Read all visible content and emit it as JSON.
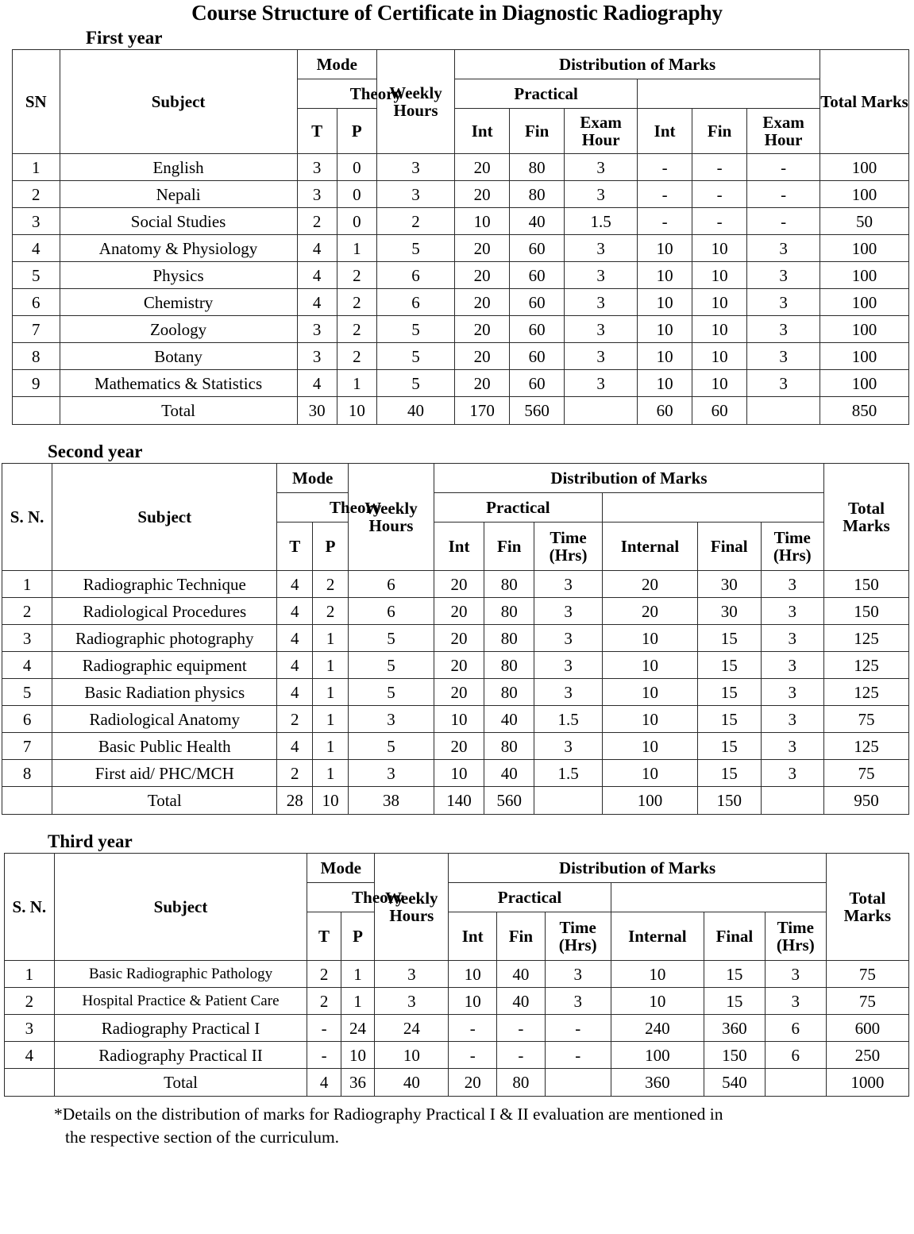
{
  "document": {
    "title": "Course Structure of Certificate in Diagnostic Radiography",
    "footnote_line1": "*Details on the distribution of marks for Radiography Practical I & II evaluation are mentioned in",
    "footnote_line2": "the respective section of the curriculum."
  },
  "tables": [
    {
      "heading": "First year",
      "headers": {
        "sn": "SN",
        "subject": "Subject",
        "mode": "Mode",
        "mode_t": "T",
        "mode_p": "P",
        "weekly_hours": "Weekly Hours",
        "distribution": "Distribution of Marks",
        "theory": "Theory",
        "practical": "Practical",
        "theory_int": "Int",
        "theory_fin": "Fin",
        "theory_time": "Exam Hour",
        "practical_int": "Int",
        "practical_fin": "Fin",
        "practical_time": "Exam Hour",
        "total_marks": "Total Marks"
      },
      "rows": [
        {
          "sn": "1",
          "subject": "English",
          "t": "3",
          "p": "0",
          "weekly": "3",
          "th_int": "20",
          "th_fin": "80",
          "th_time": "3",
          "pr_int": "-",
          "pr_fin": "-",
          "pr_time": "-",
          "total": "100"
        },
        {
          "sn": "2",
          "subject": "Nepali",
          "t": "3",
          "p": "0",
          "weekly": "3",
          "th_int": "20",
          "th_fin": "80",
          "th_time": "3",
          "pr_int": "-",
          "pr_fin": "-",
          "pr_time": "-",
          "total": "100"
        },
        {
          "sn": "3",
          "subject": "Social Studies",
          "t": "2",
          "p": "0",
          "weekly": "2",
          "th_int": "10",
          "th_fin": "40",
          "th_time": "1.5",
          "pr_int": "-",
          "pr_fin": "-",
          "pr_time": "-",
          "total": "50"
        },
        {
          "sn": "4",
          "subject": "Anatomy & Physiology",
          "t": "4",
          "p": "1",
          "weekly": "5",
          "th_int": "20",
          "th_fin": "60",
          "th_time": "3",
          "pr_int": "10",
          "pr_fin": "10",
          "pr_time": "3",
          "total": "100"
        },
        {
          "sn": "5",
          "subject": "Physics",
          "t": "4",
          "p": "2",
          "weekly": "6",
          "th_int": "20",
          "th_fin": "60",
          "th_time": "3",
          "pr_int": "10",
          "pr_fin": "10",
          "pr_time": "3",
          "total": "100"
        },
        {
          "sn": "6",
          "subject": "Chemistry",
          "t": "4",
          "p": "2",
          "weekly": "6",
          "th_int": "20",
          "th_fin": "60",
          "th_time": "3",
          "pr_int": "10",
          "pr_fin": "10",
          "pr_time": "3",
          "total": "100"
        },
        {
          "sn": "7",
          "subject": "Zoology",
          "t": "3",
          "p": "2",
          "weekly": "5",
          "th_int": "20",
          "th_fin": "60",
          "th_time": "3",
          "pr_int": "10",
          "pr_fin": "10",
          "pr_time": "3",
          "total": "100"
        },
        {
          "sn": "8",
          "subject": "Botany",
          "t": "3",
          "p": "2",
          "weekly": "5",
          "th_int": "20",
          "th_fin": "60",
          "th_time": "3",
          "pr_int": "10",
          "pr_fin": "10",
          "pr_time": "3",
          "total": "100"
        },
        {
          "sn": "9",
          "subject": "Mathematics & Statistics",
          "t": "4",
          "p": "1",
          "weekly": "5",
          "th_int": "20",
          "th_fin": "60",
          "th_time": "3",
          "pr_int": "10",
          "pr_fin": "10",
          "pr_time": "3",
          "total": "100"
        }
      ],
      "total": {
        "sn": "",
        "label": "Total",
        "t": "30",
        "p": "10",
        "weekly": "40",
        "th_int": "170",
        "th_fin": "560",
        "th_time": "",
        "pr_int": "60",
        "pr_fin": "60",
        "pr_time": "",
        "total": "850"
      }
    },
    {
      "heading": "Second year",
      "headers": {
        "sn": "S. N.",
        "subject": "Subject",
        "mode": "Mode",
        "mode_t": "T",
        "mode_p": "P",
        "weekly_hours": "Weekly Hours",
        "distribution": "Distribution of Marks",
        "theory": "Theory",
        "practical": "Practical",
        "theory_int": "Int",
        "theory_fin": "Fin",
        "theory_time": "Time (Hrs)",
        "practical_int": "Internal",
        "practical_fin": "Final",
        "practical_time": "Time (Hrs)",
        "total_marks": "Total Marks"
      },
      "rows": [
        {
          "sn": "1",
          "subject": "Radiographic Technique",
          "t": "4",
          "p": "2",
          "weekly": "6",
          "th_int": "20",
          "th_fin": "80",
          "th_time": "3",
          "pr_int": "20",
          "pr_fin": "30",
          "pr_time": "3",
          "total": "150"
        },
        {
          "sn": "2",
          "subject": "Radiological Procedures",
          "t": "4",
          "p": "2",
          "weekly": "6",
          "th_int": "20",
          "th_fin": "80",
          "th_time": "3",
          "pr_int": "20",
          "pr_fin": "30",
          "pr_time": "3",
          "total": "150"
        },
        {
          "sn": "3",
          "subject": "Radiographic photography",
          "t": "4",
          "p": "1",
          "weekly": "5",
          "th_int": "20",
          "th_fin": "80",
          "th_time": "3",
          "pr_int": "10",
          "pr_fin": "15",
          "pr_time": "3",
          "total": "125"
        },
        {
          "sn": "4",
          "subject": "Radiographic equipment",
          "t": "4",
          "p": "1",
          "weekly": "5",
          "th_int": "20",
          "th_fin": "80",
          "th_time": "3",
          "pr_int": "10",
          "pr_fin": "15",
          "pr_time": "3",
          "total": "125"
        },
        {
          "sn": "5",
          "subject": "Basic Radiation physics",
          "t": "4",
          "p": "1",
          "weekly": "5",
          "th_int": "20",
          "th_fin": "80",
          "th_time": "3",
          "pr_int": "10",
          "pr_fin": "15",
          "pr_time": "3",
          "total": "125"
        },
        {
          "sn": "6",
          "subject": "Radiological Anatomy",
          "t": "2",
          "p": "1",
          "weekly": "3",
          "th_int": "10",
          "th_fin": "40",
          "th_time": "1.5",
          "pr_int": "10",
          "pr_fin": "15",
          "pr_time": "3",
          "total": "75"
        },
        {
          "sn": "7",
          "subject": "Basic Public Health",
          "t": "4",
          "p": "1",
          "weekly": "5",
          "th_int": "20",
          "th_fin": "80",
          "th_time": "3",
          "pr_int": "10",
          "pr_fin": "15",
          "pr_time": "3",
          "total": "125"
        },
        {
          "sn": "8",
          "subject": "First aid/ PHC/MCH",
          "t": "2",
          "p": "1",
          "weekly": "3",
          "th_int": "10",
          "th_fin": "40",
          "th_time": "1.5",
          "pr_int": "10",
          "pr_fin": "15",
          "pr_time": "3",
          "total": "75"
        }
      ],
      "total": {
        "sn": "",
        "label": "Total",
        "t": "28",
        "p": "10",
        "weekly": "38",
        "th_int": "140",
        "th_fin": "560",
        "th_time": "",
        "pr_int": "100",
        "pr_fin": "150",
        "pr_time": "",
        "total": "950"
      }
    },
    {
      "heading": "Third year",
      "headers": {
        "sn": "S. N.",
        "subject": "Subject",
        "mode": "Mode",
        "mode_t": "T",
        "mode_p": "P",
        "weekly_hours": "Weekly Hours",
        "distribution": "Distribution of Marks",
        "theory": "Theory",
        "practical": "Practical",
        "theory_int": "Int",
        "theory_fin": "Fin",
        "theory_time": "Time (Hrs)",
        "practical_int": "Internal",
        "practical_fin": "Final",
        "practical_time": "Time (Hrs)",
        "total_marks": "Total Marks"
      },
      "rows": [
        {
          "sn": "1",
          "subject": "Basic Radiographic Pathology",
          "t": "2",
          "p": "1",
          "weekly": "3",
          "th_int": "10",
          "th_fin": "40",
          "th_time": "3",
          "pr_int": "10",
          "pr_fin": "15",
          "pr_time": "3",
          "total": "75"
        },
        {
          "sn": "2",
          "subject": "Hospital Practice & Patient Care",
          "t": "2",
          "p": "1",
          "weekly": "3",
          "th_int": "10",
          "th_fin": "40",
          "th_time": "3",
          "pr_int": "10",
          "pr_fin": "15",
          "pr_time": "3",
          "total": "75"
        },
        {
          "sn": "3",
          "subject": "Radiography Practical I",
          "t": "-",
          "p": "24",
          "weekly": "24",
          "th_int": "-",
          "th_fin": "-",
          "th_time": "-",
          "pr_int": "240",
          "pr_fin": "360",
          "pr_time": "6",
          "total": "600"
        },
        {
          "sn": "4",
          "subject": "Radiography Practical II",
          "t": "-",
          "p": "10",
          "weekly": "10",
          "th_int": "-",
          "th_fin": "-",
          "th_time": "-",
          "pr_int": "100",
          "pr_fin": "150",
          "pr_time": "6",
          "total": "250"
        }
      ],
      "total": {
        "sn": "",
        "label": "Total",
        "t": "4",
        "p": "36",
        "weekly": "40",
        "th_int": "20",
        "th_fin": "80",
        "th_time": "",
        "pr_int": "360",
        "pr_fin": "540",
        "pr_time": "",
        "total": "1000"
      }
    }
  ]
}
